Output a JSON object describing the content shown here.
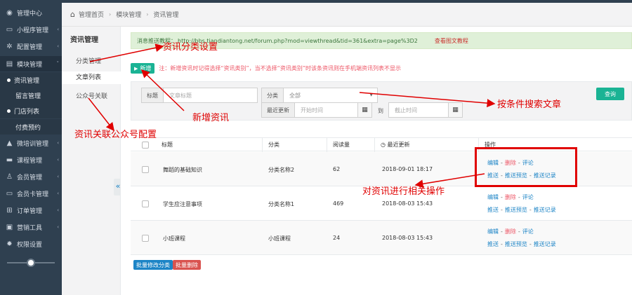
{
  "sidebar": {
    "items": [
      {
        "icon": "palette-icon",
        "glyph": "◉",
        "label": "管理中心",
        "arrow": ""
      },
      {
        "icon": "monitor-icon",
        "glyph": "▭",
        "label": "小程序管理",
        "arrow": "‹"
      },
      {
        "icon": "gears-icon",
        "glyph": "✲",
        "label": "配置管理",
        "arrow": "‹"
      },
      {
        "icon": "grid-icon",
        "glyph": "▤",
        "label": "模块管理",
        "arrow": "˅"
      }
    ],
    "subitems": [
      {
        "label": "资讯管理",
        "dot": true
      },
      {
        "label": "留言管理",
        "dot": false
      },
      {
        "label": "门店列表",
        "dot": true
      },
      {
        "label": "付费预约",
        "dot": false
      }
    ],
    "more": [
      {
        "icon": "graduation-cap-icon",
        "glyph": "▲",
        "label": "微培训管理",
        "arrow": "‹"
      },
      {
        "icon": "book-icon",
        "glyph": "▬",
        "label": "课程管理",
        "arrow": "‹"
      },
      {
        "icon": "user-icon",
        "glyph": "♙",
        "label": "会员管理",
        "arrow": "‹"
      },
      {
        "icon": "card-icon",
        "glyph": "▭",
        "label": "会员卡管理",
        "arrow": "‹"
      },
      {
        "icon": "cart-icon",
        "glyph": "⊞",
        "label": "订单管理",
        "arrow": "‹"
      },
      {
        "icon": "briefcase-icon",
        "glyph": "▣",
        "label": "营销工具",
        "arrow": "‹"
      },
      {
        "icon": "gear-icon",
        "glyph": "✹",
        "label": "权限设置",
        "arrow": ""
      }
    ]
  },
  "breadcrumb": [
    "管理首页",
    "模块管理",
    "资讯管理"
  ],
  "subnav": {
    "title": "资讯管理",
    "items": [
      "分类管理",
      "文章列表",
      "公众号关联"
    ]
  },
  "notice": {
    "prefix": "消息推送教程：",
    "url": "http://bbs.tiandiantong.net/forum.php?mod=viewthread&tid=361&extra=page%3D2",
    "link": "查看图文教程"
  },
  "add": {
    "button": "新增",
    "note": "注：新增资讯时记得选择“资讯类别”，当不选择“资讯类别”时该条资讯则在手机端资讯列表不显示"
  },
  "filter": {
    "title_label": "标题",
    "title_placeholder": "文章标题",
    "category_label": "分类",
    "category_value": "全部",
    "updated_label": "最近更新",
    "start_placeholder": "开始时间",
    "to_label": "到",
    "end_placeholder": "截止时间",
    "search_button": "查询"
  },
  "table": {
    "headers": [
      "标题",
      "分类",
      "阅读量",
      "最近更新",
      "操作"
    ],
    "rows": [
      {
        "title": "舞蹈的基础知识",
        "category": "分类名称2",
        "reads": "62",
        "updated": "2018-09-01 18:17"
      },
      {
        "title": "学生应注意事项",
        "category": "分类名称1",
        "reads": "469",
        "updated": "2018-08-03 15:43"
      },
      {
        "title": "小班课程",
        "category": "小班课程",
        "reads": "24",
        "updated": "2018-08-03 15:43"
      }
    ],
    "ops_line1": {
      "edit": "编辑",
      "delete": "删除",
      "comment": "评论",
      "sep": "-"
    },
    "ops_line2": {
      "push": "推送",
      "preview": "推送预览",
      "record": "推送记录",
      "sep": "-"
    }
  },
  "bulk": {
    "edit_category": "批量修改分类",
    "delete": "批量删除"
  },
  "collapse_glyph": "«",
  "annotations": {
    "category": "资讯分类设置",
    "add_news": "新增资讯",
    "search": "按条件搜索文章",
    "link_account": "资讯关联公众号配置",
    "operate": "对资讯进行相关操作"
  },
  "colors": {
    "sidebar": "#2f4050",
    "primary": "#1ab394",
    "link": "#1c84c6",
    "danger": "#ed5565",
    "annotation": "#e00000"
  }
}
